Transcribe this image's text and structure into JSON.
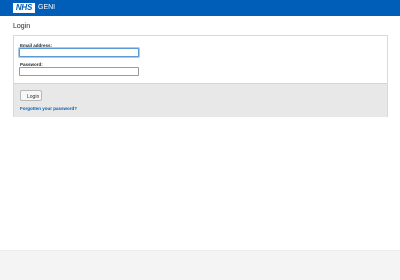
{
  "header": {
    "logo_text": "NHS",
    "app_name": "GENI",
    "background_color": "#005eb8"
  },
  "page": {
    "title": "Login"
  },
  "form": {
    "email_label": "Email address:",
    "email_value": "",
    "password_label": "Password:",
    "password_value": "",
    "login_button_label": "Login",
    "forgot_password_link": "Forgotten your password?"
  }
}
